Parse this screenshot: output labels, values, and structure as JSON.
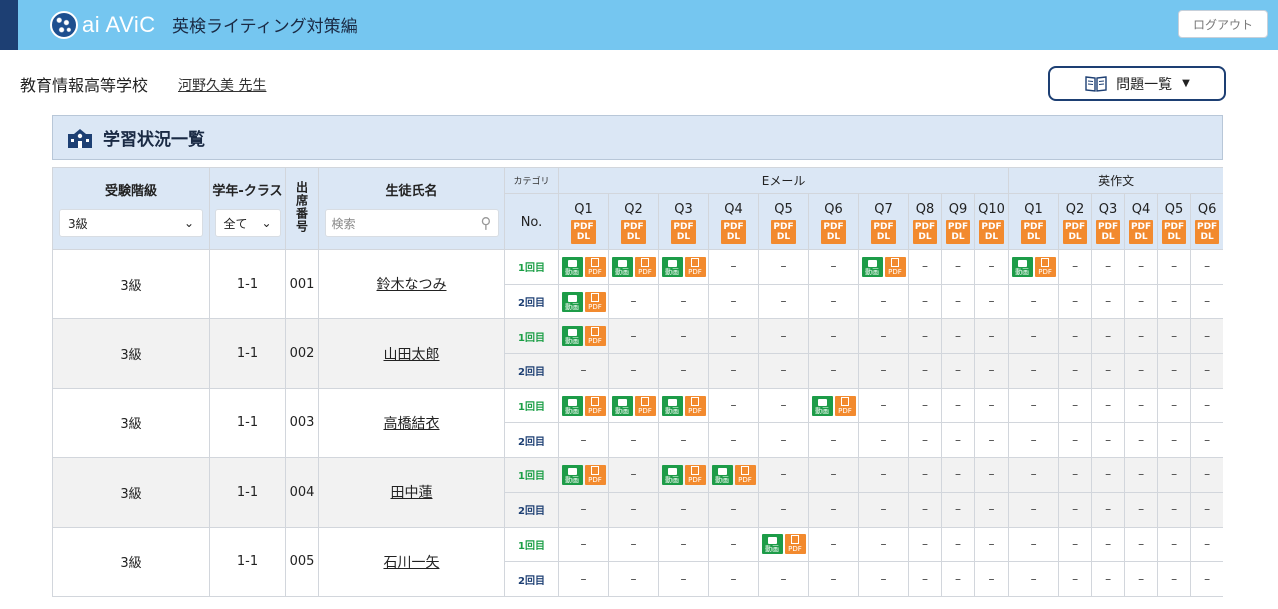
{
  "header": {
    "logo_text": "ai AViC",
    "app_title": "英検ライティング対策編",
    "logout_label": "ログアウト"
  },
  "school_bar": {
    "school_name": "教育情報高等学校",
    "teacher_name": "河野久美 先生",
    "question_list_label": "問題一覧"
  },
  "panel": {
    "title": "学習状況一覧"
  },
  "table": {
    "headers": {
      "grade": "受験階級",
      "class": "学年-クラス",
      "number": "出席番号",
      "name": "生徒氏名",
      "category": "カテゴリ",
      "no": "No."
    },
    "filters": {
      "grade_value": "3級",
      "class_value": "全て",
      "search_placeholder": "検索"
    },
    "groups": [
      {
        "label": "Eメール",
        "questions": [
          "Q1",
          "Q2",
          "Q3",
          "Q4",
          "Q5",
          "Q6",
          "Q7",
          "Q8",
          "Q9",
          "Q10"
        ]
      },
      {
        "label": "英作文",
        "questions": [
          "Q1",
          "Q2",
          "Q3",
          "Q4",
          "Q5",
          "Q6"
        ]
      }
    ],
    "pdf_dl_label_1": "PDF",
    "pdf_dl_label_2": "DL",
    "attempt_labels": [
      "1回目",
      "2回目"
    ],
    "icon_video_label": "動画",
    "icon_pdf_label": "PDF",
    "dash": "–",
    "students": [
      {
        "grade": "3級",
        "class": "1-1",
        "number": "001",
        "name": "鈴木なつみ",
        "attempts": [
          [
            "done",
            "done",
            "done",
            "-",
            "-",
            "-",
            "done",
            "-",
            "-",
            "-",
            "done",
            "-",
            "-",
            "-",
            "-",
            "-"
          ],
          [
            "done",
            "-",
            "-",
            "-",
            "-",
            "-",
            "-",
            "-",
            "-",
            "-",
            "-",
            "-",
            "-",
            "-",
            "-",
            "-"
          ]
        ]
      },
      {
        "grade": "3級",
        "class": "1-1",
        "number": "002",
        "name": "山田太郎",
        "attempts": [
          [
            "done",
            "-",
            "-",
            "-",
            "-",
            "-",
            "-",
            "-",
            "-",
            "-",
            "-",
            "-",
            "-",
            "-",
            "-",
            "-"
          ],
          [
            "-",
            "-",
            "-",
            "-",
            "-",
            "-",
            "-",
            "-",
            "-",
            "-",
            "-",
            "-",
            "-",
            "-",
            "-",
            "-"
          ]
        ]
      },
      {
        "grade": "3級",
        "class": "1-1",
        "number": "003",
        "name": "高橋結衣",
        "attempts": [
          [
            "done",
            "done",
            "done",
            "-",
            "-",
            "done",
            "-",
            "-",
            "-",
            "-",
            "-",
            "-",
            "-",
            "-",
            "-",
            "-"
          ],
          [
            "-",
            "-",
            "-",
            "-",
            "-",
            "-",
            "-",
            "-",
            "-",
            "-",
            "-",
            "-",
            "-",
            "-",
            "-",
            "-"
          ]
        ]
      },
      {
        "grade": "3級",
        "class": "1-1",
        "number": "004",
        "name": "田中蓮",
        "attempts": [
          [
            "done",
            "-",
            "done",
            "done",
            "-",
            "-",
            "-",
            "-",
            "-",
            "-",
            "-",
            "-",
            "-",
            "-",
            "-",
            "-"
          ],
          [
            "-",
            "-",
            "-",
            "-",
            "-",
            "-",
            "-",
            "-",
            "-",
            "-",
            "-",
            "-",
            "-",
            "-",
            "-",
            "-"
          ]
        ]
      },
      {
        "grade": "3級",
        "class": "1-1",
        "number": "005",
        "name": "石川一矢",
        "attempts": [
          [
            "-",
            "-",
            "-",
            "-",
            "done",
            "-",
            "-",
            "-",
            "-",
            "-",
            "-",
            "-",
            "-",
            "-",
            "-",
            "-"
          ],
          [
            "-",
            "-",
            "-",
            "-",
            "-",
            "-",
            "-",
            "-",
            "-",
            "-",
            "-",
            "-",
            "-",
            "-",
            "-",
            "-"
          ]
        ]
      }
    ]
  },
  "colors": {
    "header_bg": "#75c6f0",
    "header_stripe": "#1d3f73",
    "table_header_bg": "#dbe7f5",
    "video_green": "#1d9c48",
    "pdf_orange": "#f28a2e",
    "attempt1_green": "#1a9e45",
    "attempt2_navy": "#1d3f73"
  }
}
